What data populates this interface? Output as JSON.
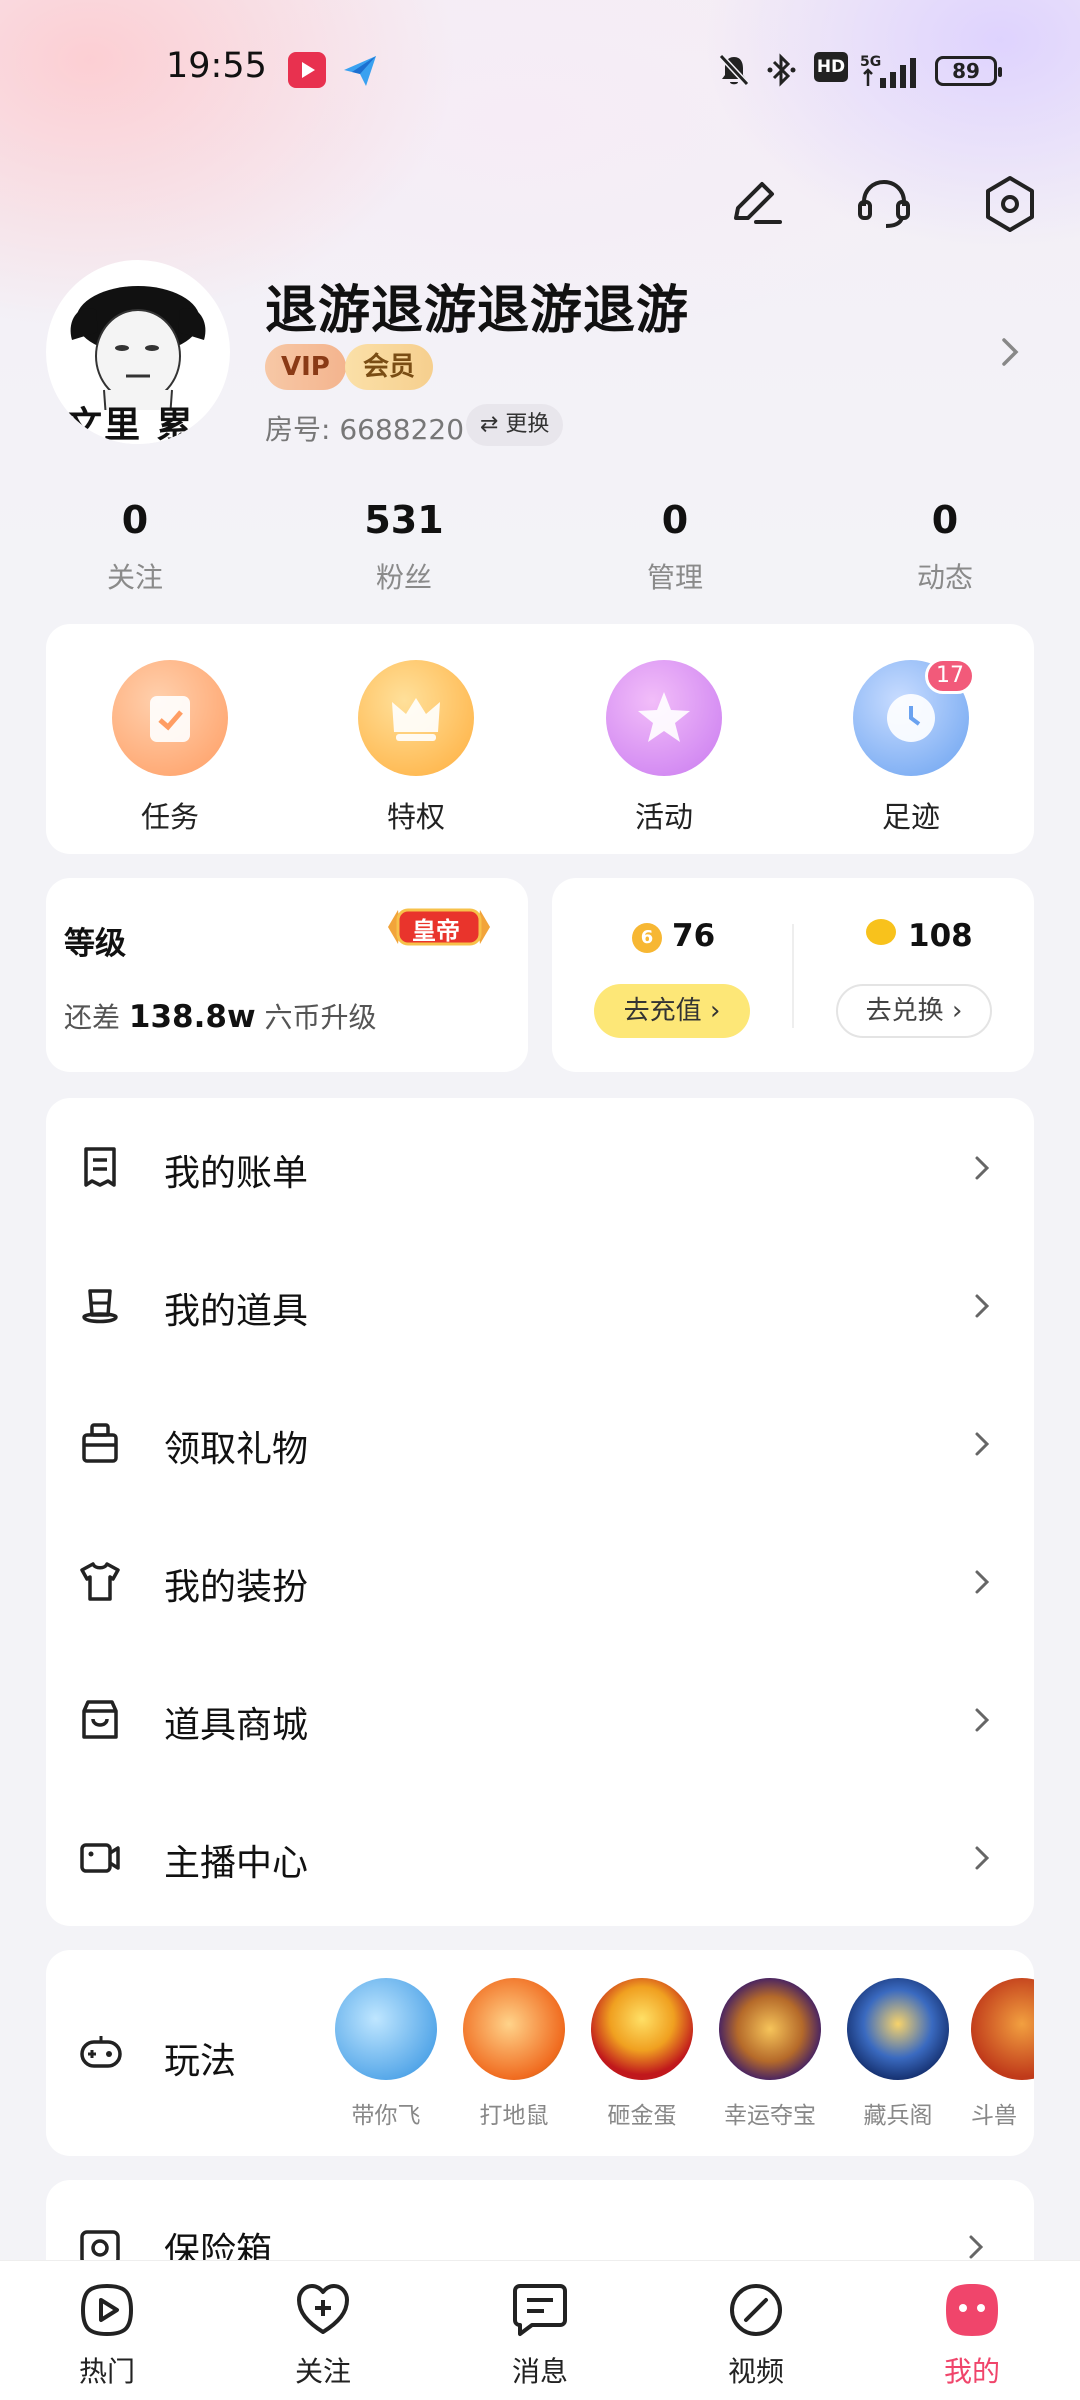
{
  "status_bar": {
    "time": "19:55",
    "battery": "89",
    "network": "5G"
  },
  "header": {
    "edit_icon": "pencil-icon",
    "service_icon": "headset-icon",
    "settings_icon": "settings-hexagon-icon"
  },
  "profile": {
    "username": "退游退游退游退游",
    "vip_badge": "VIP",
    "member_badge": "会员",
    "room_label": "房号: 6688220",
    "change_label": "⇄ 更换",
    "avatar_text": "文里 累"
  },
  "stats": [
    {
      "value": "0",
      "label": "关注"
    },
    {
      "value": "531",
      "label": "粉丝"
    },
    {
      "value": "0",
      "label": "管理"
    },
    {
      "value": "0",
      "label": "动态"
    }
  ],
  "quick_actions": [
    {
      "label": "任务",
      "icon": "task-icon"
    },
    {
      "label": "特权",
      "icon": "crown-icon"
    },
    {
      "label": "活动",
      "icon": "star-icon"
    },
    {
      "label": "足迹",
      "icon": "clock-icon",
      "badge": "17"
    }
  ],
  "level": {
    "title": "等级",
    "need_prefix": "还差 ",
    "need_amount": "138.8w",
    "need_suffix": " 六币升级",
    "rank_badge": "皇帝"
  },
  "wallet": {
    "coins": "76",
    "recharge_label": "去充值",
    "beans": "108",
    "exchange_label": "去兑换"
  },
  "menu": [
    {
      "label": "我的账单",
      "icon": "receipt-icon"
    },
    {
      "label": "我的道具",
      "icon": "hat-icon"
    },
    {
      "label": "领取礼物",
      "icon": "gift-icon"
    },
    {
      "label": "我的装扮",
      "icon": "tshirt-icon"
    },
    {
      "label": "道具商城",
      "icon": "store-icon"
    },
    {
      "label": "主播中心",
      "icon": "video-camera-icon"
    }
  ],
  "games": {
    "title": "玩法",
    "items": [
      "带你飞",
      "打地鼠",
      "砸金蛋",
      "幸运夺宝",
      "藏兵阁",
      "斗兽"
    ]
  },
  "safe": {
    "label": "保险箱"
  },
  "tabs": [
    {
      "label": "热门",
      "icon": "play-circle-icon"
    },
    {
      "label": "关注",
      "icon": "heart-plus-icon"
    },
    {
      "label": "消息",
      "icon": "message-icon"
    },
    {
      "label": "视频",
      "icon": "slash-circle-icon"
    },
    {
      "label": "我的",
      "icon": "face-icon",
      "active": true
    }
  ],
  "colors": {
    "accent": "#f0456b",
    "recharge_pill": "#fde777",
    "task": "#ffb07a",
    "privilege": "#ffc25a",
    "activity": "#d98af5",
    "footprint": "#8cb8f5"
  }
}
